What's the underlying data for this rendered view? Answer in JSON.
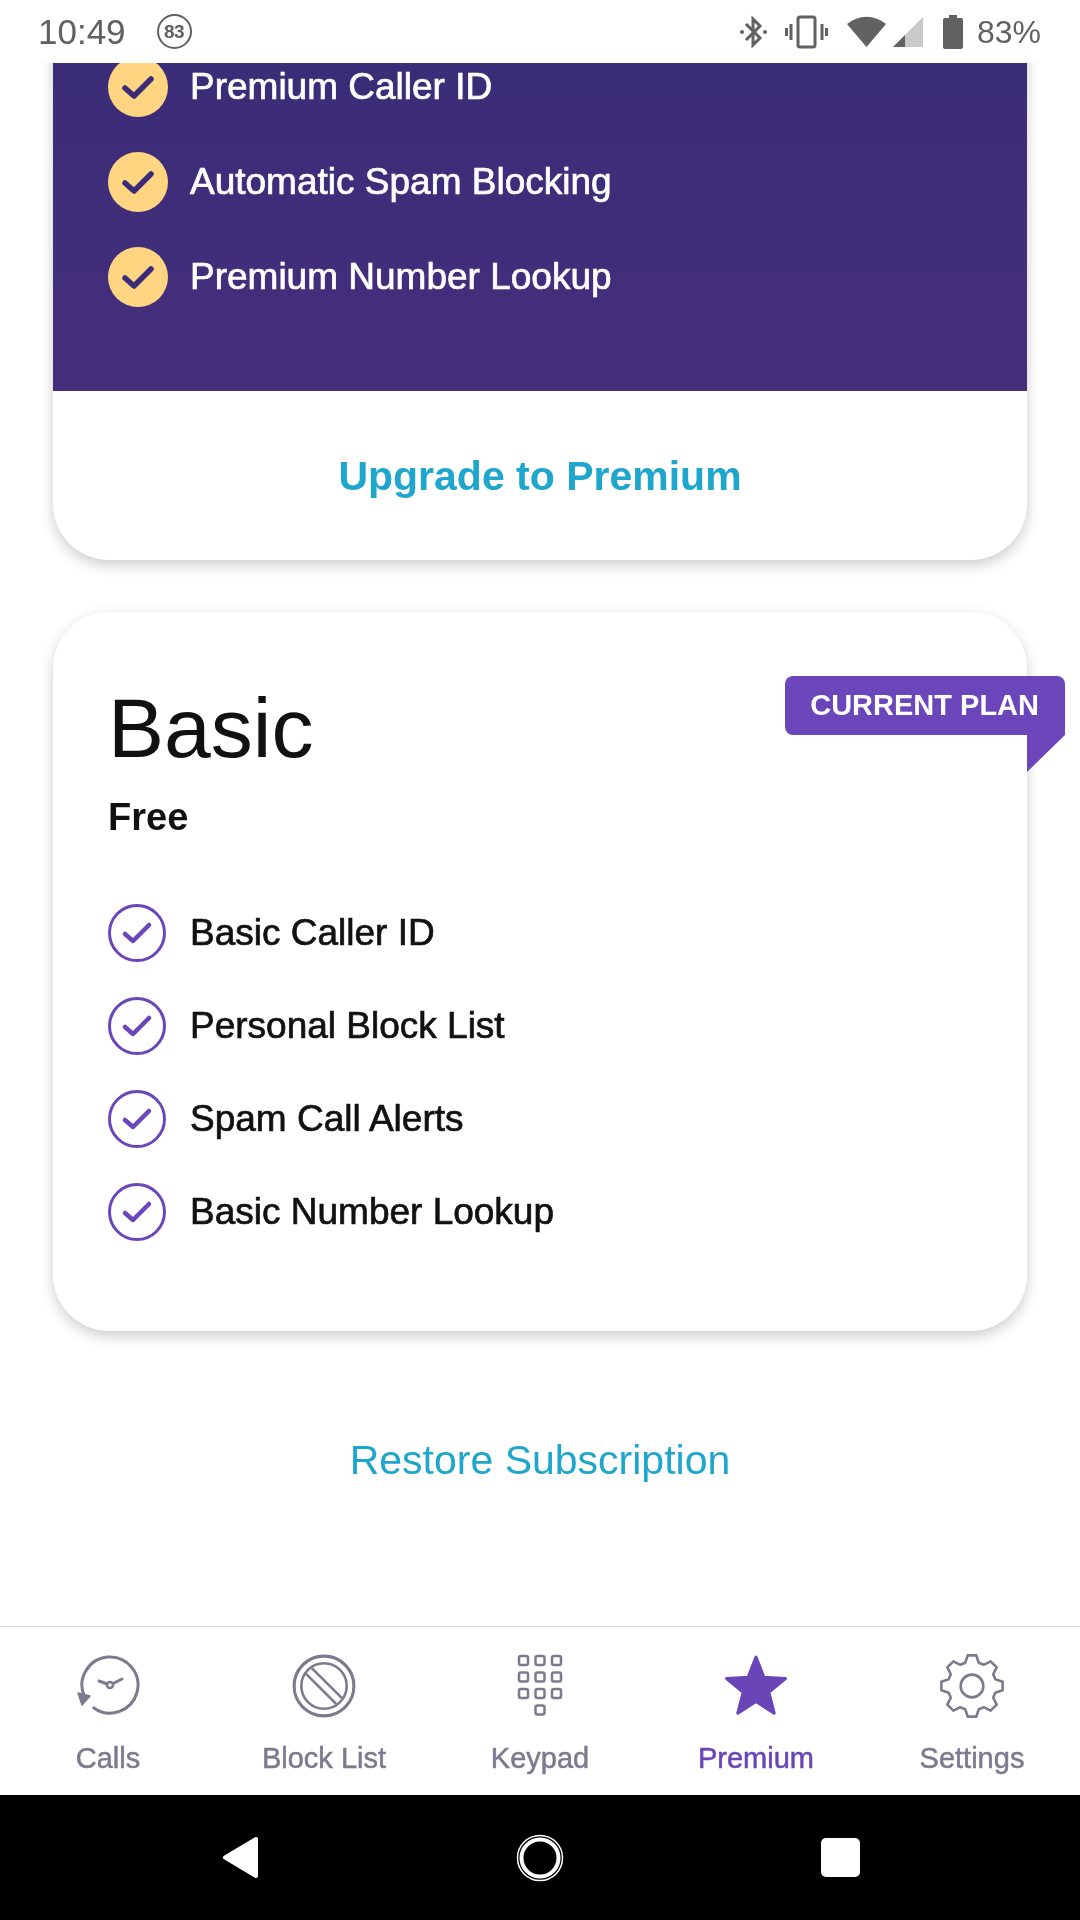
{
  "status_bar": {
    "time": "10:49",
    "notification_count": "83",
    "battery": "83%"
  },
  "premium_card": {
    "features": [
      "Premium Caller ID",
      "Automatic Spam Blocking",
      "Premium Number Lookup"
    ],
    "upgrade_button": "Upgrade to Premium"
  },
  "basic_card": {
    "title": "Basic",
    "price": "Free",
    "badge": "CURRENT PLAN",
    "features": [
      "Basic Caller ID",
      "Personal Block List",
      "Spam Call Alerts",
      "Basic Number Lookup"
    ]
  },
  "restore_link": "Restore Subscription",
  "bottom_nav": [
    {
      "label": "Calls",
      "selected": false
    },
    {
      "label": "Block List",
      "selected": false
    },
    {
      "label": "Keypad",
      "selected": false
    },
    {
      "label": "Premium",
      "selected": true
    },
    {
      "label": "Settings",
      "selected": false
    }
  ]
}
